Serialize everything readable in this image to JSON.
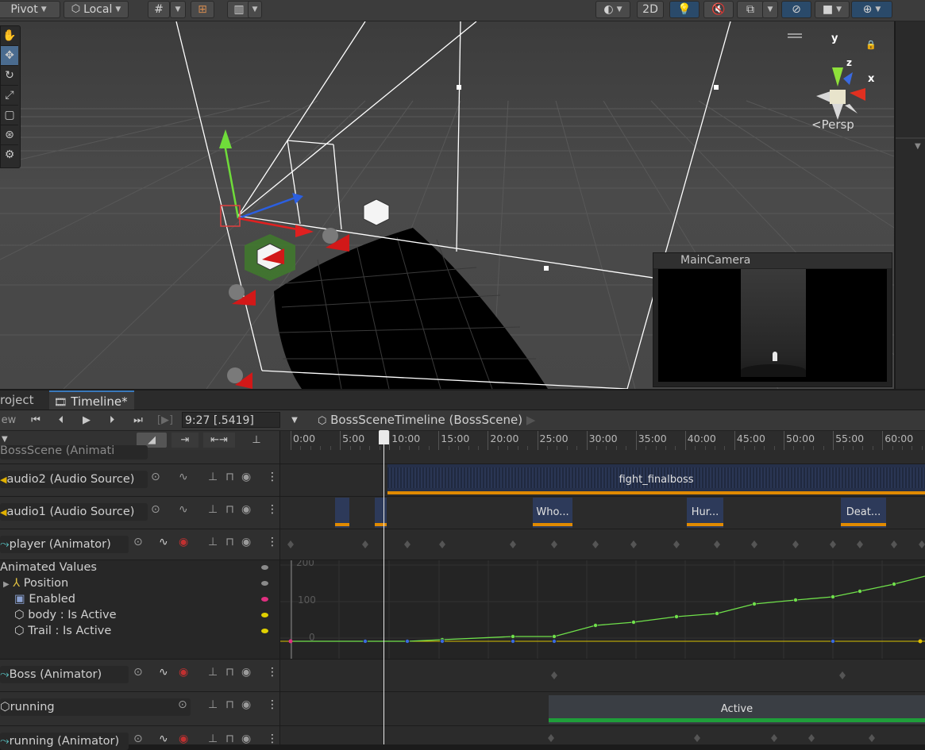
{
  "toolbar": {
    "pivot_label": "Pivot",
    "local_label": "Local",
    "mode_2d_label": "2D"
  },
  "scene": {
    "persp_label": "Persp",
    "gizmo_x": "x",
    "gizmo_y": "y",
    "gizmo_z": "z",
    "camera_preview_title": "MainCamera"
  },
  "tabs": [
    {
      "label": "roject"
    },
    {
      "label": "Timeline*"
    }
  ],
  "timeline": {
    "preview_label": "ew",
    "time_value": "9:27 [.5419]",
    "breadcrumb": "BossSceneTimeline (BossScene)",
    "ruler_ticks": [
      "0:00",
      "5:00",
      "10:00",
      "15:00",
      "20:00",
      "25:00",
      "30:00",
      "35:00",
      "40:00",
      "45:00",
      "50:00",
      "55:00",
      "60:00"
    ],
    "first_track_partial": "BossScene (Animati",
    "tracks": [
      {
        "name": "audio2 (Audio Source)",
        "clips": [
          {
            "label": "fight_finalboss"
          }
        ]
      },
      {
        "name": "audio1 (Audio Source)",
        "clips": [
          {
            "label": "Who..."
          },
          {
            "label": "Hur..."
          },
          {
            "label": "Deat..."
          }
        ]
      },
      {
        "name": "player (Animator)"
      },
      {
        "name": "Boss (Animator)"
      },
      {
        "name": "running",
        "clips": [
          {
            "label": "Active"
          }
        ]
      },
      {
        "name": "running (Animator)"
      }
    ],
    "animated_values": {
      "header": "Animated Values",
      "properties": [
        "Position",
        "Enabled",
        "body : Is Active",
        "Trail : Is Active"
      ],
      "y_labels": [
        "200",
        "100",
        "0"
      ]
    }
  },
  "colors": {
    "clip_orange": "#e08a00",
    "clip_blue": "#2d3a5a",
    "activation_green": "#1f9e3a",
    "curve_green": "#6fe04a",
    "curve_yellow": "#d8c200"
  }
}
